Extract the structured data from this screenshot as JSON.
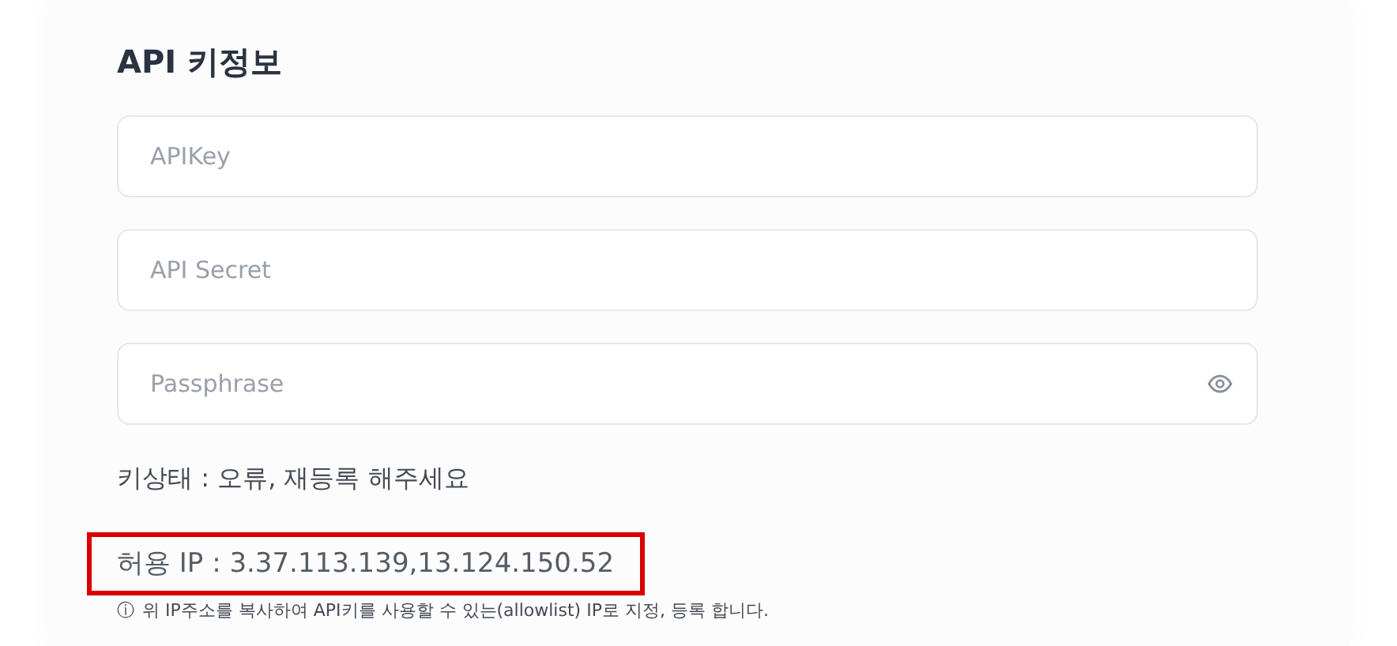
{
  "title": "API 키정보",
  "fields": [
    {
      "kind": "text",
      "placeholder": "APIKey"
    },
    {
      "kind": "text",
      "placeholder": "API Secret"
    },
    {
      "kind": "password",
      "placeholder": "Passphrase"
    }
  ],
  "key_status": "키상태 : 오류, 재등록 해주세요",
  "allowed_ip": {
    "text": "허용 IP : 3.37.113.139,13.124.150.52",
    "highlighted": true
  },
  "note": {
    "icon": "ⓘ",
    "text": "위 IP주소를 복사하여 API키를 사용할 수 있는(allowlist) IP로 지정, 등록 합니다."
  }
}
